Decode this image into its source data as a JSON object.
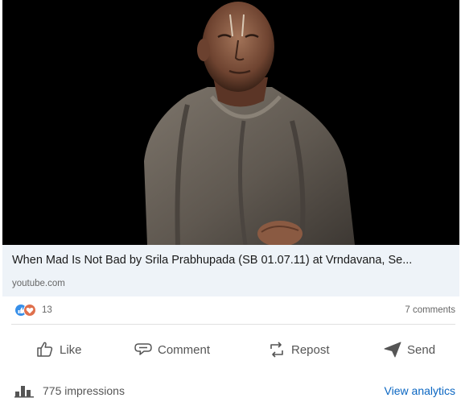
{
  "link_preview": {
    "title": "When Mad Is Not Bad by Srila Prabhupada (SB 01.07.11) at Vrndavana, Se...",
    "domain": "youtube.com"
  },
  "social": {
    "reaction_count": "13",
    "comments": "7 comments",
    "reaction_icons": [
      "like-reaction-icon",
      "love-reaction-icon"
    ]
  },
  "actions": {
    "like": "Like",
    "comment": "Comment",
    "repost": "Repost",
    "send": "Send"
  },
  "footer": {
    "impressions": "775 impressions",
    "view_analytics": "View analytics"
  },
  "colors": {
    "link_card_bg": "#eef3f8",
    "analytics_link": "#0a66c2",
    "like_blue": "#378fe9",
    "love_red": "#df704d"
  }
}
